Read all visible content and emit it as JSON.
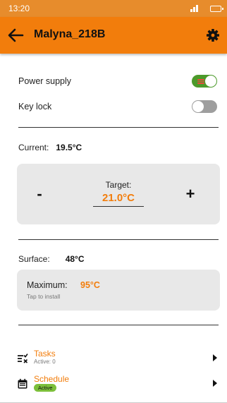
{
  "status_bar": {
    "time": "13:20"
  },
  "app_bar": {
    "title": "Malyna_218B",
    "back_icon": "arrow-left-icon",
    "settings_icon": "gear-icon"
  },
  "power_supply": {
    "label": "Power supply",
    "enabled": true
  },
  "key_lock": {
    "label": "Key lock",
    "enabled": false
  },
  "current": {
    "label": "Current:",
    "value": "19.5°C"
  },
  "target": {
    "label": "Target:",
    "value": "21.0°C",
    "minus_label": "-",
    "plus_label": "+"
  },
  "surface": {
    "label": "Surface:",
    "value": "48°C"
  },
  "maximum": {
    "label": "Maximum:",
    "value": "95°C",
    "hint": "Tap to install"
  },
  "tasks": {
    "title": "Tasks",
    "subtitle": "Active: 0",
    "icon": "tasks-icon"
  },
  "schedule": {
    "title": "Schedule",
    "badge": "Active",
    "icon": "calendar-icon"
  },
  "colors": {
    "accent": "#f27d0c",
    "toggle_on": "#4c9a2a",
    "toggle_off": "#9e9e9e",
    "badge": "#7cbf3a"
  }
}
